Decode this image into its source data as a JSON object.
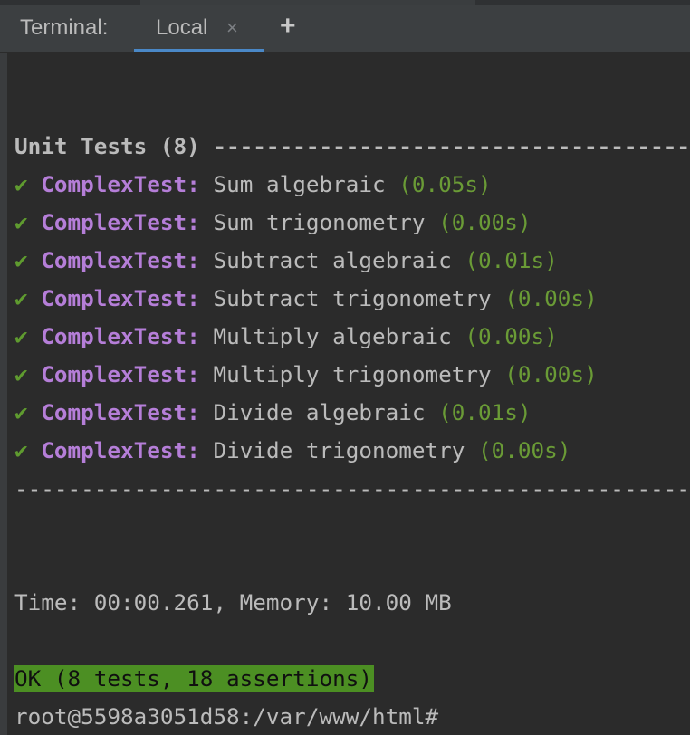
{
  "tabbar": {
    "title": "Terminal:",
    "tab_label": "Local",
    "close_glyph": "×",
    "add_glyph": "+"
  },
  "terminal": {
    "header": "Unit Tests (8) ---------------------------------------------",
    "tests": [
      {
        "check": "✔",
        "class": "ComplexTest:",
        "name": "Sum algebraic",
        "time": "(0.05s)"
      },
      {
        "check": "✔",
        "class": "ComplexTest:",
        "name": "Sum trigonometry",
        "time": "(0.00s)"
      },
      {
        "check": "✔",
        "class": "ComplexTest:",
        "name": "Subtract algebraic",
        "time": "(0.01s)"
      },
      {
        "check": "✔",
        "class": "ComplexTest:",
        "name": "Subtract trigonometry",
        "time": "(0.00s)"
      },
      {
        "check": "✔",
        "class": "ComplexTest:",
        "name": "Multiply algebraic",
        "time": "(0.00s)"
      },
      {
        "check": "✔",
        "class": "ComplexTest:",
        "name": "Multiply trigonometry",
        "time": "(0.00s)"
      },
      {
        "check": "✔",
        "class": "ComplexTest:",
        "name": "Divide algebraic",
        "time": "(0.01s)"
      },
      {
        "check": "✔",
        "class": "ComplexTest:",
        "name": "Divide trigonometry",
        "time": "(0.00s)"
      }
    ],
    "separator": "--------------------------------------------------------------",
    "time_memory": "Time: 00:00.261, Memory: 10.00 MB",
    "result": "OK (8 tests, 18 assertions)",
    "prompt": "root@5598a3051d58:/var/www/html#"
  },
  "colors": {
    "background": "#2b2b2b",
    "text": "#bbbbbb",
    "class_name": "#b57ed8",
    "timing": "#6a9b36",
    "ok_background": "#4c8f23",
    "tab_underline": "#4a88c7"
  }
}
